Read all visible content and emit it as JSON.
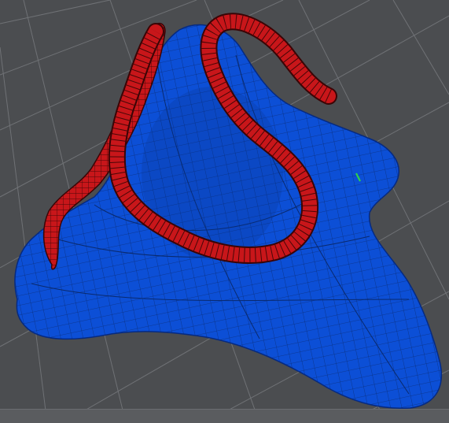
{
  "viewport": {
    "background_color": "#4b4d50",
    "grid_color": "#9a9ca0",
    "surface_color": "#0c4fd6",
    "surface_wire_color": "#0a2a6e",
    "tube_color": "#c8161a",
    "tube_wire_color": "#3a0506",
    "marker_color": "#2fd14a"
  },
  "objects": [
    {
      "kind": "surface",
      "icon": "mesh-surface-icon"
    },
    {
      "kind": "tube",
      "icon": "tube-curve-icon"
    },
    {
      "kind": "tube",
      "icon": "tube-curve-icon"
    }
  ]
}
